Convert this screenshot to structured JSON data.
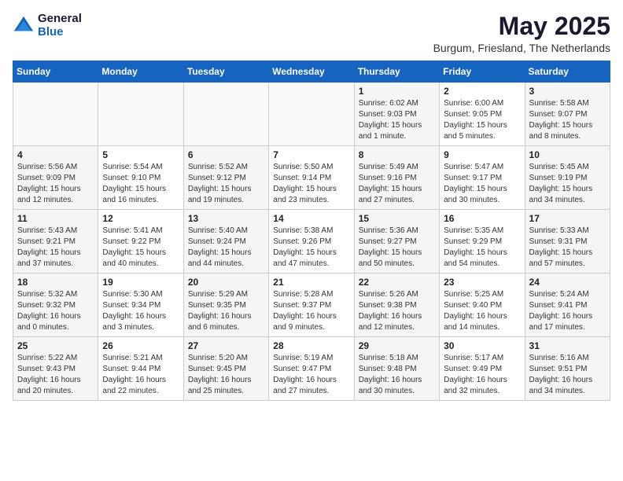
{
  "header": {
    "logo": {
      "general": "General",
      "blue": "Blue"
    },
    "title": "May 2025",
    "subtitle": "Burgum, Friesland, The Netherlands"
  },
  "days_of_week": [
    "Sunday",
    "Monday",
    "Tuesday",
    "Wednesday",
    "Thursday",
    "Friday",
    "Saturday"
  ],
  "weeks": [
    [
      {
        "day": "",
        "content": ""
      },
      {
        "day": "",
        "content": ""
      },
      {
        "day": "",
        "content": ""
      },
      {
        "day": "",
        "content": ""
      },
      {
        "day": "1",
        "content": "Sunrise: 6:02 AM\nSunset: 9:03 PM\nDaylight: 15 hours\nand 1 minute."
      },
      {
        "day": "2",
        "content": "Sunrise: 6:00 AM\nSunset: 9:05 PM\nDaylight: 15 hours\nand 5 minutes."
      },
      {
        "day": "3",
        "content": "Sunrise: 5:58 AM\nSunset: 9:07 PM\nDaylight: 15 hours\nand 8 minutes."
      }
    ],
    [
      {
        "day": "4",
        "content": "Sunrise: 5:56 AM\nSunset: 9:09 PM\nDaylight: 15 hours\nand 12 minutes."
      },
      {
        "day": "5",
        "content": "Sunrise: 5:54 AM\nSunset: 9:10 PM\nDaylight: 15 hours\nand 16 minutes."
      },
      {
        "day": "6",
        "content": "Sunrise: 5:52 AM\nSunset: 9:12 PM\nDaylight: 15 hours\nand 19 minutes."
      },
      {
        "day": "7",
        "content": "Sunrise: 5:50 AM\nSunset: 9:14 PM\nDaylight: 15 hours\nand 23 minutes."
      },
      {
        "day": "8",
        "content": "Sunrise: 5:49 AM\nSunset: 9:16 PM\nDaylight: 15 hours\nand 27 minutes."
      },
      {
        "day": "9",
        "content": "Sunrise: 5:47 AM\nSunset: 9:17 PM\nDaylight: 15 hours\nand 30 minutes."
      },
      {
        "day": "10",
        "content": "Sunrise: 5:45 AM\nSunset: 9:19 PM\nDaylight: 15 hours\nand 34 minutes."
      }
    ],
    [
      {
        "day": "11",
        "content": "Sunrise: 5:43 AM\nSunset: 9:21 PM\nDaylight: 15 hours\nand 37 minutes."
      },
      {
        "day": "12",
        "content": "Sunrise: 5:41 AM\nSunset: 9:22 PM\nDaylight: 15 hours\nand 40 minutes."
      },
      {
        "day": "13",
        "content": "Sunrise: 5:40 AM\nSunset: 9:24 PM\nDaylight: 15 hours\nand 44 minutes."
      },
      {
        "day": "14",
        "content": "Sunrise: 5:38 AM\nSunset: 9:26 PM\nDaylight: 15 hours\nand 47 minutes."
      },
      {
        "day": "15",
        "content": "Sunrise: 5:36 AM\nSunset: 9:27 PM\nDaylight: 15 hours\nand 50 minutes."
      },
      {
        "day": "16",
        "content": "Sunrise: 5:35 AM\nSunset: 9:29 PM\nDaylight: 15 hours\nand 54 minutes."
      },
      {
        "day": "17",
        "content": "Sunrise: 5:33 AM\nSunset: 9:31 PM\nDaylight: 15 hours\nand 57 minutes."
      }
    ],
    [
      {
        "day": "18",
        "content": "Sunrise: 5:32 AM\nSunset: 9:32 PM\nDaylight: 16 hours\nand 0 minutes."
      },
      {
        "day": "19",
        "content": "Sunrise: 5:30 AM\nSunset: 9:34 PM\nDaylight: 16 hours\nand 3 minutes."
      },
      {
        "day": "20",
        "content": "Sunrise: 5:29 AM\nSunset: 9:35 PM\nDaylight: 16 hours\nand 6 minutes."
      },
      {
        "day": "21",
        "content": "Sunrise: 5:28 AM\nSunset: 9:37 PM\nDaylight: 16 hours\nand 9 minutes."
      },
      {
        "day": "22",
        "content": "Sunrise: 5:26 AM\nSunset: 9:38 PM\nDaylight: 16 hours\nand 12 minutes."
      },
      {
        "day": "23",
        "content": "Sunrise: 5:25 AM\nSunset: 9:40 PM\nDaylight: 16 hours\nand 14 minutes."
      },
      {
        "day": "24",
        "content": "Sunrise: 5:24 AM\nSunset: 9:41 PM\nDaylight: 16 hours\nand 17 minutes."
      }
    ],
    [
      {
        "day": "25",
        "content": "Sunrise: 5:22 AM\nSunset: 9:43 PM\nDaylight: 16 hours\nand 20 minutes."
      },
      {
        "day": "26",
        "content": "Sunrise: 5:21 AM\nSunset: 9:44 PM\nDaylight: 16 hours\nand 22 minutes."
      },
      {
        "day": "27",
        "content": "Sunrise: 5:20 AM\nSunset: 9:45 PM\nDaylight: 16 hours\nand 25 minutes."
      },
      {
        "day": "28",
        "content": "Sunrise: 5:19 AM\nSunset: 9:47 PM\nDaylight: 16 hours\nand 27 minutes."
      },
      {
        "day": "29",
        "content": "Sunrise: 5:18 AM\nSunset: 9:48 PM\nDaylight: 16 hours\nand 30 minutes."
      },
      {
        "day": "30",
        "content": "Sunrise: 5:17 AM\nSunset: 9:49 PM\nDaylight: 16 hours\nand 32 minutes."
      },
      {
        "day": "31",
        "content": "Sunrise: 5:16 AM\nSunset: 9:51 PM\nDaylight: 16 hours\nand 34 minutes."
      }
    ]
  ]
}
